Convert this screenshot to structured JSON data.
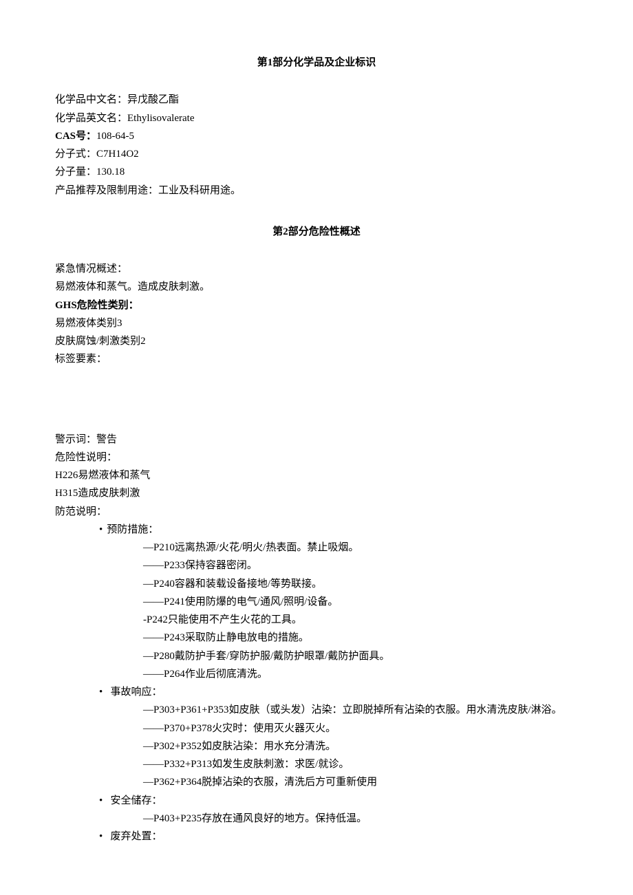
{
  "section1": {
    "title": "第1部分化学品及企业标识",
    "name_cn_label": "化学品中文名：",
    "name_cn": "异戊酸乙酯",
    "name_en_label": "化学品英文名：",
    "name_en": "Ethylisovalerate",
    "cas_label": "CAS号：",
    "cas": "108-64-5",
    "formula_label": "分子式：",
    "formula": "C7H14O2",
    "mw_label": "分子量：",
    "mw": "130.18",
    "use_label": "产品推荐及限制用途：",
    "use": "工业及科研用途。"
  },
  "section2": {
    "title": "第2部分危险性概述",
    "emergency_label": "紧急情况概述：",
    "emergency_text": "易燃液体和蒸气。造成皮肤刺激。",
    "ghs_label": "GHS危险性类别：",
    "ghs_class_1": "易燃液体类别3",
    "ghs_class_2": "皮肤腐蚀/刺激类别2",
    "label_elements": "标签要素：",
    "signal_label": "警示词：",
    "signal_word": "警告",
    "hazard_label": "危险性说明：",
    "h226": "H226易燃液体和蒸气",
    "h315": "H315造成皮肤刺激",
    "precaution_label": "防范说明：",
    "prevention": {
      "title": "预防措施：",
      "p210": "—P210远离热源/火花/明火/热表面。禁止吸烟。",
      "p233": "——P233保持容器密闭。",
      "p240": "—P240容器和装载设备接地/等势联接。",
      "p241": "——P241使用防爆的电气/通风/照明/设备。",
      "p242": "-P242只能使用不产生火花的工具。",
      "p243": "——P243采取防止静电放电的措施。",
      "p280": "—P280戴防护手套/穿防护服/戴防护眼罩/戴防护面具。",
      "p264": "——P264作业后彻底清洗。"
    },
    "response": {
      "title": "事故响应：",
      "p303": "—P303+P361+P353如皮肤（或头发）沾染：立即脱掉所有沾染的衣服。用水清洗皮肤/淋浴。",
      "p370": "——P370+P378火灾时：使用灭火器灭火。",
      "p302": "—P302+P352如皮肤沾染：用水充分清洗。",
      "p332": "——P332+P313如发生皮肤刺激：求医/就诊。",
      "p362": "—P362+P364脱掉沾染的衣服，清洗后方可重新使用"
    },
    "storage": {
      "title": "安全储存：",
      "p403": "—P403+P235存放在通风良好的地方。保持低温。"
    },
    "disposal": {
      "title": "废弃处置："
    }
  }
}
